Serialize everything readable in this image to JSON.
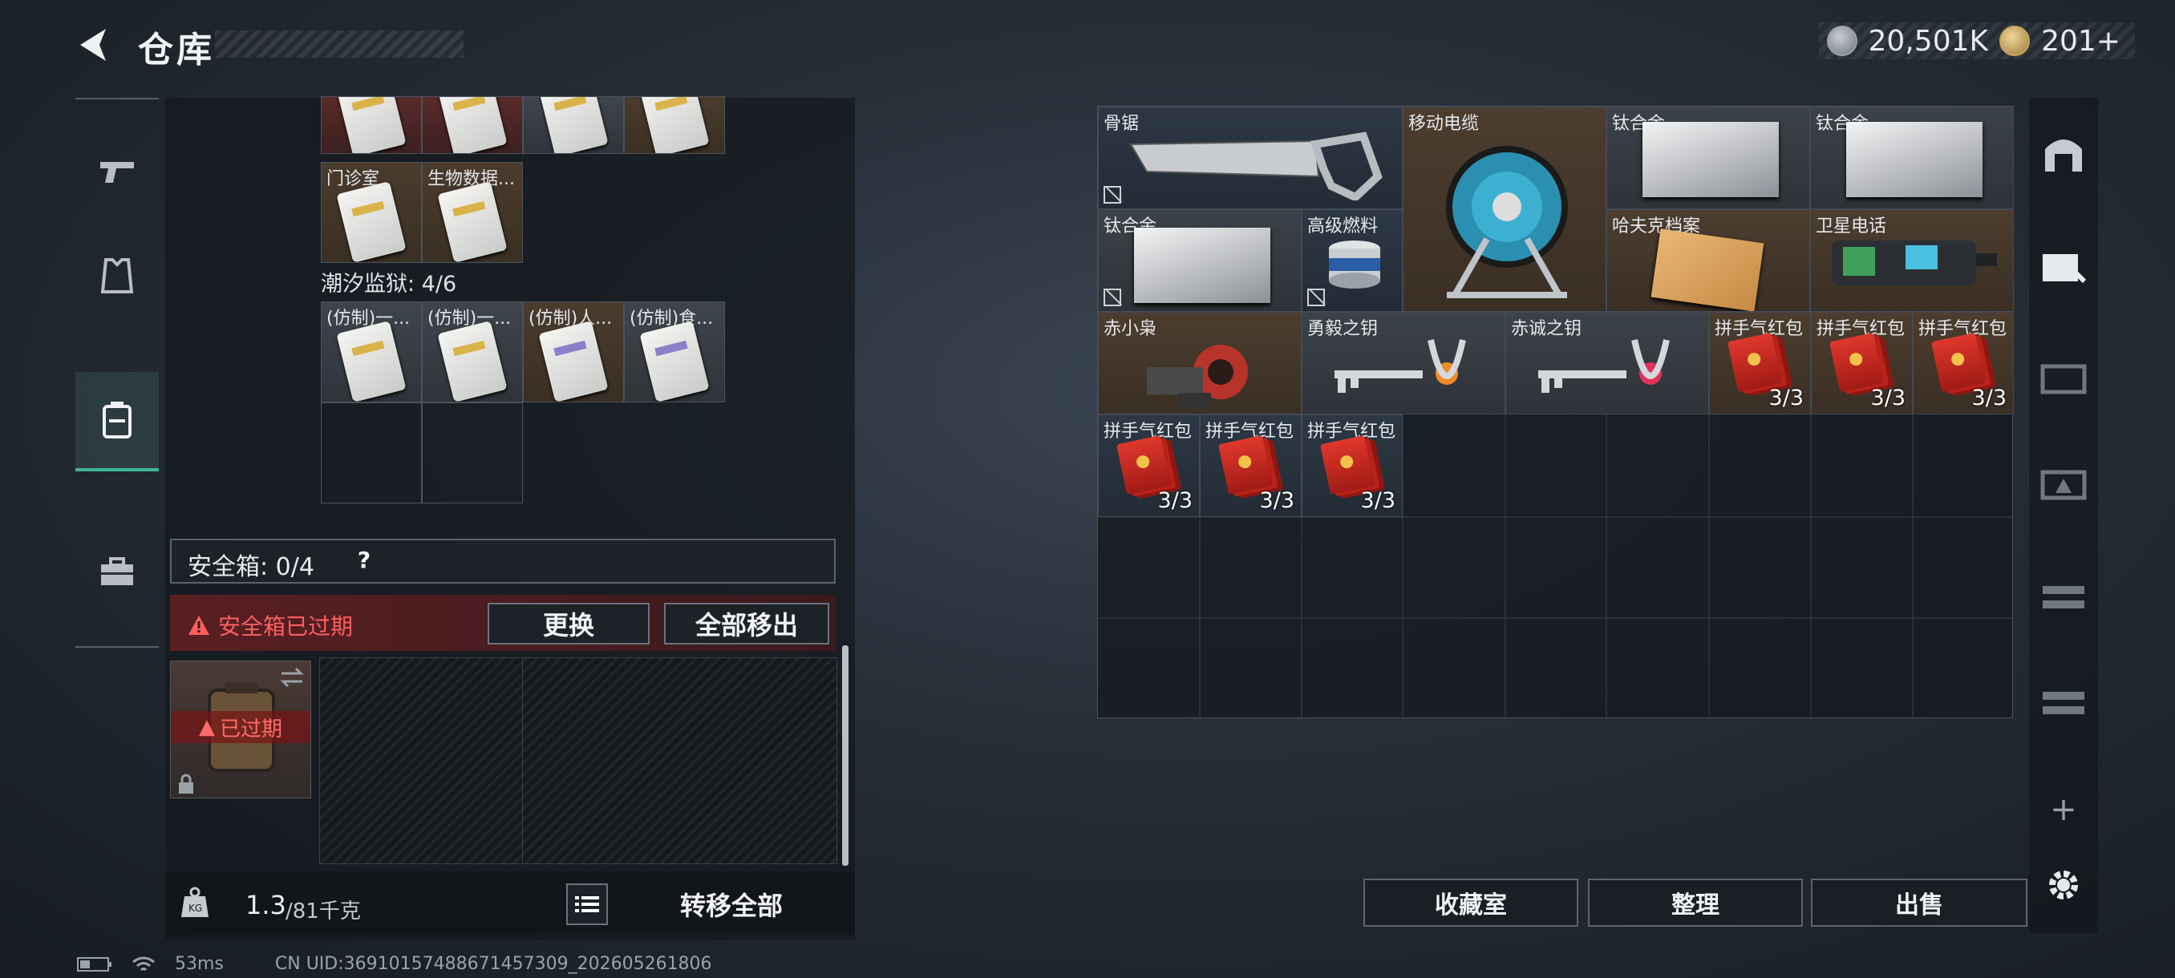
{
  "header": {
    "title": "仓库",
    "currency_silver": "20,501K",
    "currency_gold": "201+"
  },
  "left": {
    "top_cells": [
      {
        "label": "门诊室",
        "bg": "brown"
      },
      {
        "label": "生物数据...",
        "bg": "brown"
      }
    ],
    "prison_label": "潮汐监狱: 4/6",
    "prison_cells": [
      {
        "label": "(仿制)一...",
        "bg": "grey"
      },
      {
        "label": "(仿制)一...",
        "bg": "grey"
      },
      {
        "label": "(仿制)人...",
        "bg": "brown"
      },
      {
        "label": "(仿制)食...",
        "bg": "grey"
      }
    ],
    "safe_box_label": "安全箱: 0/4",
    "safe_box_help": "?",
    "expired_warning": "安全箱已过期",
    "replace_button": "更换",
    "move_all_out_button": "全部移出",
    "case_status": "已过期",
    "weight_value": "1.3",
    "weight_max": "/81千克",
    "transfer_all_button": "转移全部"
  },
  "right": {
    "items": [
      {
        "label": "骨锯"
      },
      {
        "label": "移动电缆"
      },
      {
        "label": "钛合金"
      },
      {
        "label": "钛合金"
      },
      {
        "label": "钛合金"
      },
      {
        "label": "高级燃料"
      },
      {
        "label": "哈夫克档案"
      },
      {
        "label": "卫星电话"
      },
      {
        "label": "赤小枭"
      },
      {
        "label": "勇毅之钥"
      },
      {
        "label": "赤诚之钥"
      },
      {
        "label": "拼手气红包",
        "count": "3/3"
      },
      {
        "label": "拼手气红包",
        "count": "3/3"
      },
      {
        "label": "拼手气红包",
        "count": "3/3"
      },
      {
        "label": "拼手气红包",
        "count": "3/3"
      },
      {
        "label": "拼手气红包",
        "count": "3/3"
      },
      {
        "label": "拼手气红包",
        "count": "3/3"
      }
    ],
    "collection_button": "收藏室",
    "sort_button": "整理",
    "sell_button": "出售",
    "plus_label": "+"
  },
  "status": {
    "ping": "53ms",
    "uid": "CN UID:3691015748867145730​9_202605261806"
  },
  "colors": {
    "accent": "#3fb59a",
    "warning": "#ff5f5f"
  }
}
